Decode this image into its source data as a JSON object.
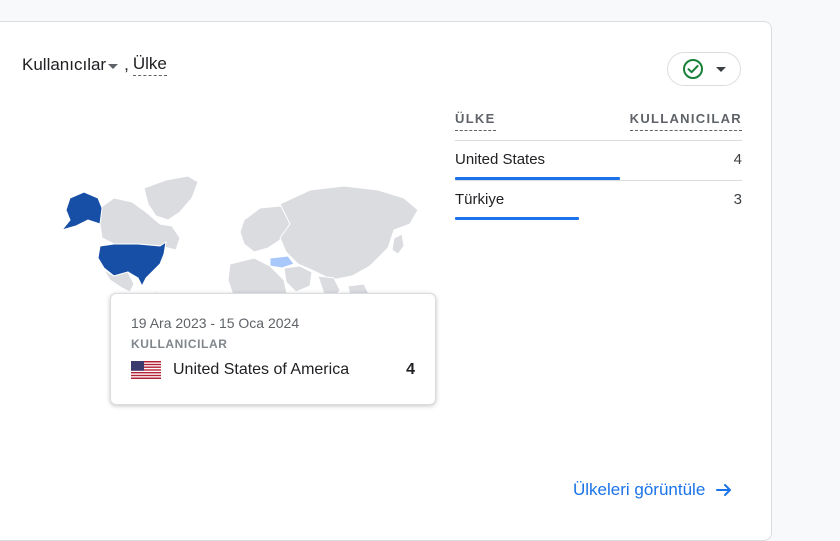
{
  "card": {
    "metric_label": "Kullanıcılar",
    "separator": ",",
    "dimension_label": "Ülke"
  },
  "compare": {
    "status_icon": "check-circle-icon",
    "accent": "#188038"
  },
  "table": {
    "headers": {
      "country": "ÜLKE",
      "users": "KULLANICILAR"
    },
    "rows": [
      {
        "country": "United States",
        "users": "4",
        "share": 1.0
      },
      {
        "country": "Türkiye",
        "users": "3",
        "share": 0.75
      }
    ]
  },
  "tooltip": {
    "date_range": "19 Ara 2023 - 15 Oca 2024",
    "metric": "KULLANICILAR",
    "country": "United States of America",
    "value": "4",
    "flag_icon": "us-flag-icon"
  },
  "footer": {
    "link_label": "Ülkeleri görüntüle",
    "arrow_icon": "arrow-right-icon"
  },
  "colors": {
    "highlight": "#174ea6",
    "map_base": "#dadce0",
    "link": "#1a73e8"
  }
}
